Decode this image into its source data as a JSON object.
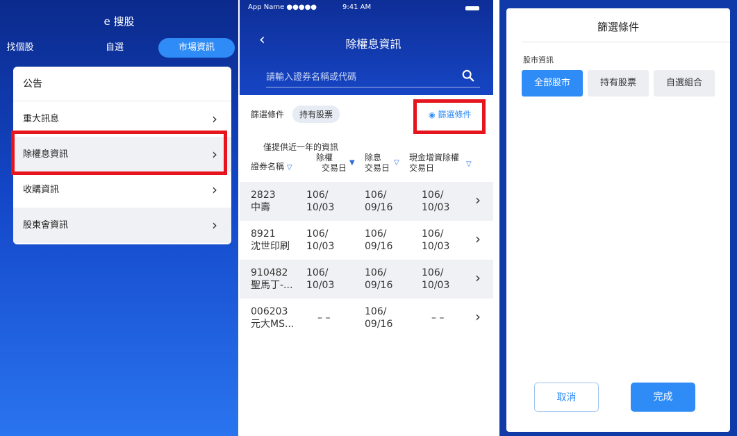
{
  "panel1": {
    "app_title": "e 搜股",
    "tabs": [
      "找個股",
      "自選",
      "市場資訊"
    ],
    "menu_header": "公告",
    "menu_items": [
      "重大訊息",
      "除權息資訊",
      "收購資訊",
      "股東會資訊"
    ]
  },
  "panel2": {
    "status_left": "App Name ●●●●●",
    "status_time": "9:41 AM",
    "title": "除權息資訊",
    "search_placeholder": "請輸入證券名稱或代碼",
    "filter_label": "篩選條件",
    "filter_chip": "持有股票",
    "filter_link": "篩選條件",
    "note": "僅提供近一年的資訊",
    "columns": {
      "name": "證券名稱",
      "rights_l1": "除權",
      "rights_l2": "交易日",
      "div_l1": "除息",
      "div_l2": "交易日",
      "cash_l1": "現金增資除權",
      "cash_l2": "交易日"
    },
    "rows": [
      {
        "code": "2823",
        "name": "中壽",
        "rights_a": "106/",
        "rights_b": "10/03",
        "div_a": "106/",
        "div_b": "09/16",
        "cash_a": "106/",
        "cash_b": "10/03"
      },
      {
        "code": "8921",
        "name": "沈世印刷",
        "rights_a": "106/",
        "rights_b": "10/03",
        "div_a": "106/",
        "div_b": "09/16",
        "cash_a": "106/",
        "cash_b": "10/03"
      },
      {
        "code": "910482",
        "name": "聖馬丁-...",
        "rights_a": "106/",
        "rights_b": "10/03",
        "div_a": "106/",
        "div_b": "09/16",
        "cash_a": "106/",
        "cash_b": "10/03"
      },
      {
        "code": "006203",
        "name": "元大MS...",
        "rights_a": "– –",
        "rights_b": "",
        "div_a": "106/",
        "div_b": "09/16",
        "cash_a": "– –",
        "cash_b": ""
      }
    ]
  },
  "panel3": {
    "title": "篩選條件",
    "section": "股市資訊",
    "options": [
      "全部股市",
      "持有股票",
      "自選組合"
    ],
    "cancel": "取消",
    "done": "完成"
  },
  "colors": {
    "accent": "#2f8cf6",
    "highlight": "#e5141d",
    "header_blue": "#1645c4"
  }
}
